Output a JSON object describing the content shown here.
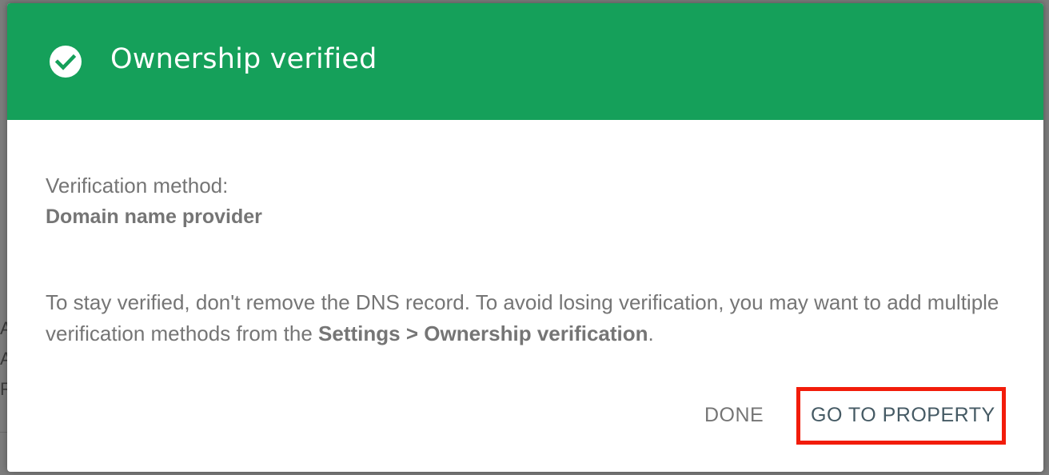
{
  "background": {
    "letters": [
      "A",
      "A",
      "R"
    ]
  },
  "dialog": {
    "title": "Ownership verified",
    "header_color": "#15a05a",
    "header_icon": "check-circle-icon",
    "method_label": "Verification method:",
    "method_value": "Domain name provider",
    "notice_text_1": "To stay verified, don't remove the DNS record. To avoid losing verification, you may want to add multiple verification methods from the ",
    "notice_bold": "Settings > Ownership verification",
    "notice_text_2": ".",
    "buttons": {
      "done": "DONE",
      "go_to_property": "GO TO PROPERTY"
    },
    "highlight_color": "#f21c0a"
  }
}
